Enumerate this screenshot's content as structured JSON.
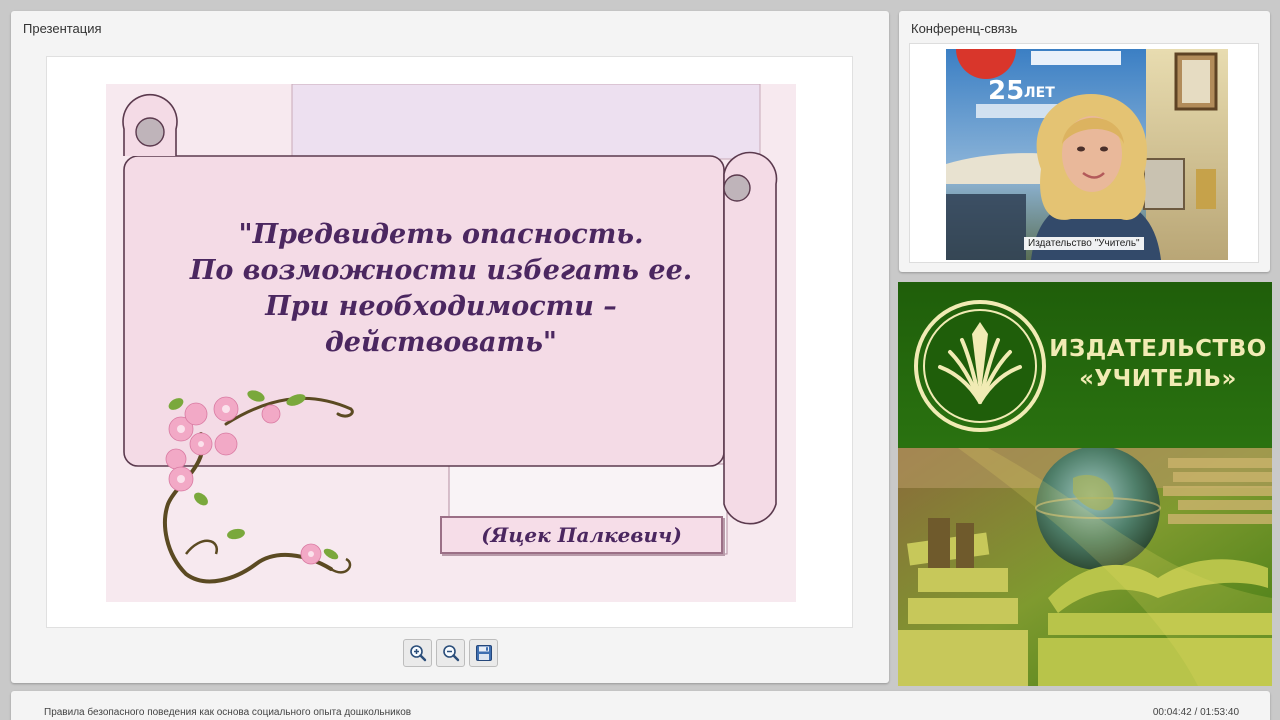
{
  "presentation": {
    "title": "Презентация",
    "slide": {
      "quote_lines": [
        "\"Предвидеть опасность.",
        "По возможности избегать ее.",
        "При необходимости –",
        "действовать\""
      ],
      "author": "(Яцек Палкевич)"
    },
    "toolbar": {
      "zoom_in_icon": "zoom-in-icon",
      "zoom_out_icon": "zoom-out-icon",
      "save_icon": "floppy-disk-icon"
    }
  },
  "conference": {
    "title": "Конференц-связь",
    "video_label": "Издательство \"Учитель\""
  },
  "brand": {
    "name_line1": "ИЗДАТЕЛЬСТВО",
    "name_line2": "«УЧИТЕЛЬ»"
  },
  "status": {
    "lecture_title": "Правила безопасного поведения как основа социального опыта дошкольников",
    "time": "00:04:42 / 01:53:40"
  },
  "colors": {
    "quote_text": "#4b2760",
    "brand_green": "#2a7210",
    "brand_text": "#f1ebb4",
    "slide_bg": "#f7e9ef"
  }
}
